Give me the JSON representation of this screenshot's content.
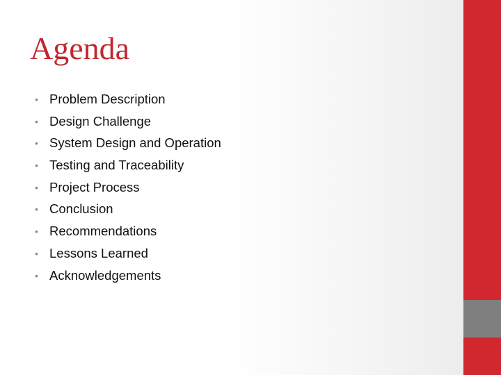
{
  "slide": {
    "title": "Agenda",
    "bullet_glyph": "•",
    "items": [
      {
        "label": "Problem Description"
      },
      {
        "label": "Design Challenge"
      },
      {
        "label": "System Design and Operation"
      },
      {
        "label": "Testing and Traceability"
      },
      {
        "label": "Project Process"
      },
      {
        "label": "Conclusion"
      },
      {
        "label": "Recommendations"
      },
      {
        "label": "Lessons Learned"
      },
      {
        "label": "Acknowledgements"
      }
    ]
  },
  "theme": {
    "accent_red": "#d1282f",
    "title_red": "#c0282f",
    "accent_gray": "#7f7f7f"
  }
}
